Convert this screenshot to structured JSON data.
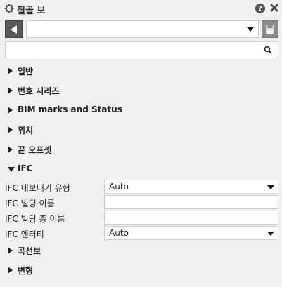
{
  "title": "철골 보",
  "icons": {
    "settings": "gear-icon",
    "help": "question-mark-icon",
    "close": "close-icon",
    "back": "back-arrow-icon",
    "save": "save-disk-icon",
    "search": "search-icon"
  },
  "help_glyph": "?",
  "search": {
    "value": "",
    "placeholder": ""
  },
  "preset_combo": {
    "value": ""
  },
  "sections": [
    {
      "label": "일반",
      "expanded": false
    },
    {
      "label": "번호 시리즈",
      "expanded": false
    },
    {
      "label": "BIM marks and Status",
      "expanded": false
    },
    {
      "label": "위치",
      "expanded": false
    },
    {
      "label": "끝 오프셋",
      "expanded": false
    },
    {
      "label": "IFC",
      "expanded": true
    },
    {
      "label": "곡선보",
      "expanded": false
    },
    {
      "label": "변형",
      "expanded": false
    }
  ],
  "ifc_properties": [
    {
      "label": "IFC 내보내기 유형",
      "value": "Auto",
      "dropdown": true
    },
    {
      "label": "IFC 빌딩 이름",
      "value": "",
      "dropdown": false
    },
    {
      "label": "IFC 빌딩 층 이름",
      "value": "",
      "dropdown": false
    },
    {
      "label": "IFC 엔터티",
      "value": "Auto",
      "dropdown": true
    }
  ]
}
